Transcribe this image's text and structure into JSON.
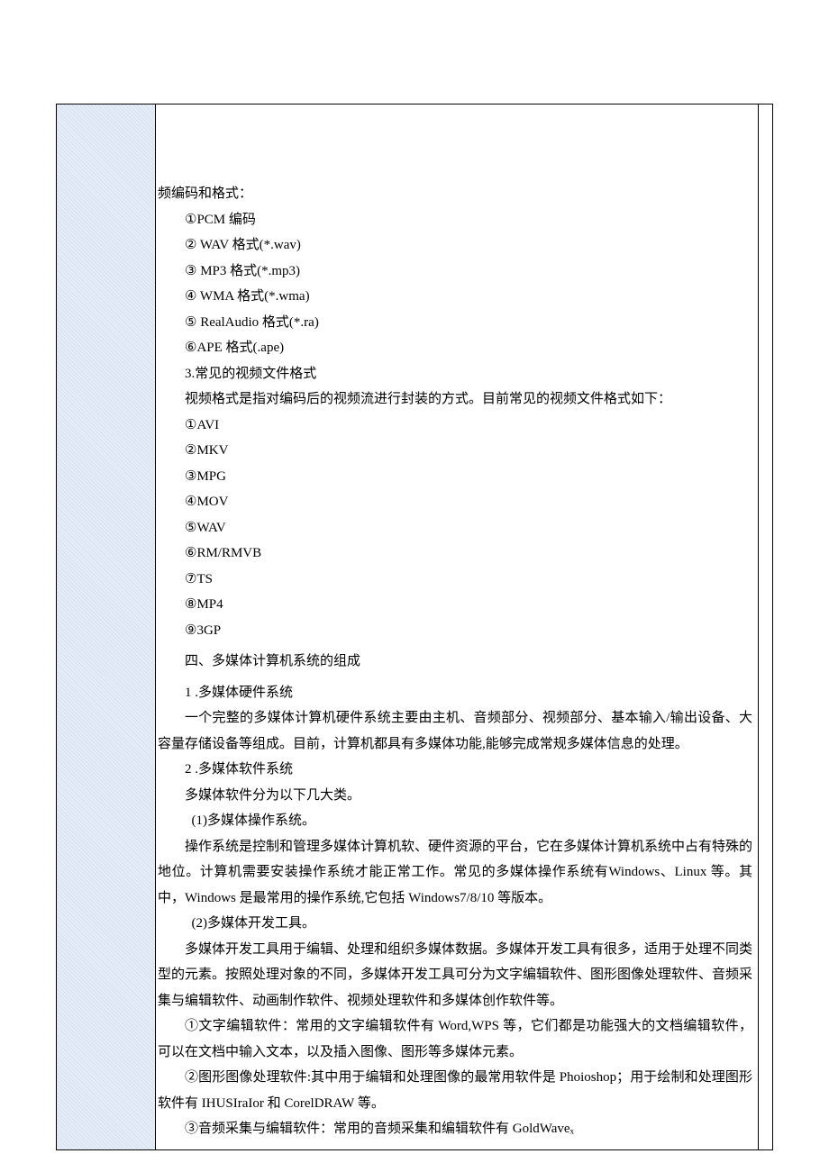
{
  "audio_heading": "频编码和格式：",
  "audio_formats": [
    "①PCM 编码",
    "②  WAV 格式(*.wav)",
    "③  MP3 格式(*.mp3)",
    "④  WMA 格式(*.wma)",
    "⑤  RealAudio 格式(*.ra)",
    "⑥APE 格式(.ape)"
  ],
  "video_section_title": " 3.常见的视频文件格式",
  "video_intro": "视频格式是指对编码后的视频流进行封装的方式。目前常见的视频文件格式如下：",
  "video_formats": [
    "①AVI",
    "②MKV",
    "③MPG",
    "④MOV",
    "⑤WAV",
    "⑥RM/RMVB",
    "⑦TS",
    "⑧MP4",
    "⑨3GP"
  ],
  "sys_heading": "四、多媒体计算机系统的组成",
  "hw_title": "1 .多媒体硬件系统",
  "hw_para": "一个完整的多媒体计算机硬件系统主要由主机、音频部分、视频部分、基本输入/输出设备、大容量存储设备等组成。目前，计算机都具有多媒体功能,能够完成常规多媒体信息的处理。",
  "sw_title": "2 .多媒体软件系统",
  "sw_intro": "多媒体软件分为以下几大类。",
  "os_title": "(1)多媒体操作系统。",
  "os_para": "操作系统是控制和管理多媒体计算机软、硬件资源的平台，它在多媒体计算机系统中占有特殊的地位。计算机需要安装操作系统才能正常工作。常见的多媒体操作系统有Windows、Linux 等。其中，Windows 是最常用的操作系统,它包括 Windows7/8/10 等版本。",
  "dev_title": "(2)多媒体开发工具。",
  "dev_para": "多媒体开发工具用于编辑、处理和组织多媒体数据。多媒体开发工具有很多，适用于处理不同类型的元素。按照处理对象的不同，多媒体开发工具可分为文字编辑软件、图形图像处理软件、音频采集与编辑软件、动画制作软件、视频处理软件和多媒体创作软件等。",
  "tool1": "①文字编辑软件：常用的文字编辑软件有 Word,WPS 等，它们都是功能强大的文档编辑软件，可以在文档中输入文本，以及插入图像、图形等多媒体元素。",
  "tool2": "②图形图像处理软件:其中用于编辑和处理图像的最常用软件是 Phoioshop；用于绘制和处理图形软件有 IHUSIraIor 和 CorelDRAW 等。",
  "tool3": "③音频采集与编辑软件：常用的音频采集和编辑软件有 GoldWaveₓ"
}
